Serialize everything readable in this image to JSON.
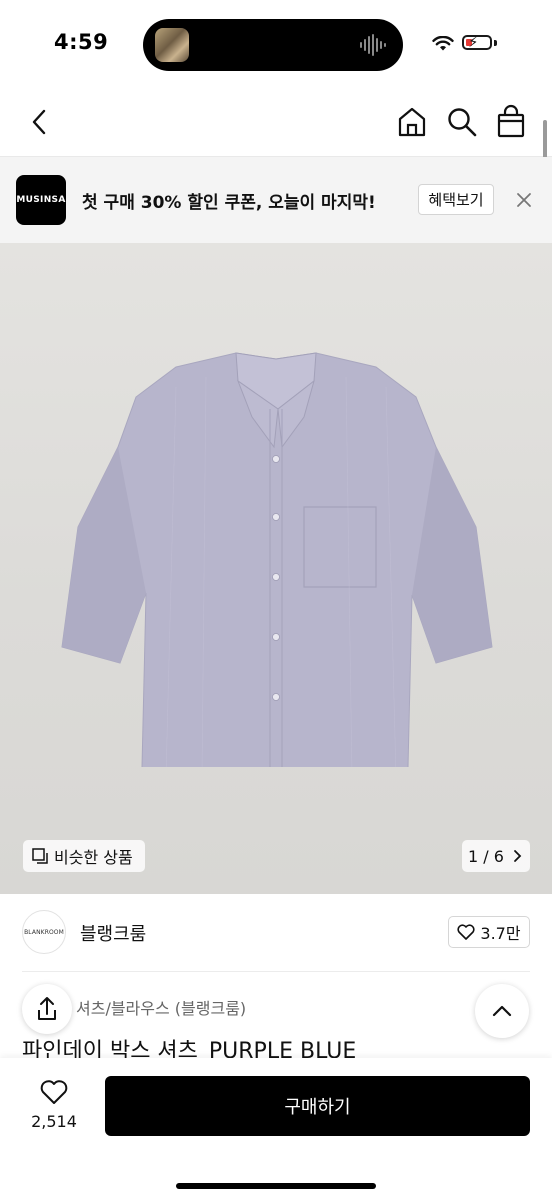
{
  "status_bar": {
    "time": "4:59"
  },
  "promo": {
    "logo_text": "MUSINSA",
    "message": "첫 구매 30% 할인 쿠폰, 오늘이 마지막!",
    "button_label": "혜택보기"
  },
  "gallery": {
    "similar_label": "비슷한 상품",
    "counter": "1 / 6"
  },
  "brand": {
    "logo_text": "BLANKROOM",
    "name": "블랭크룸",
    "likes": "3.7만"
  },
  "product": {
    "category": "셔츠/블라우스 (블랭크룸)",
    "title": "파인데이 박스 셔츠_PURPLE BLUE"
  },
  "bottom_bar": {
    "wish_count": "2,514",
    "buy_label": "구매하기"
  },
  "colors": {
    "shirt": "#b7b5cc",
    "background": "#dedddb",
    "accent": "#000000"
  }
}
